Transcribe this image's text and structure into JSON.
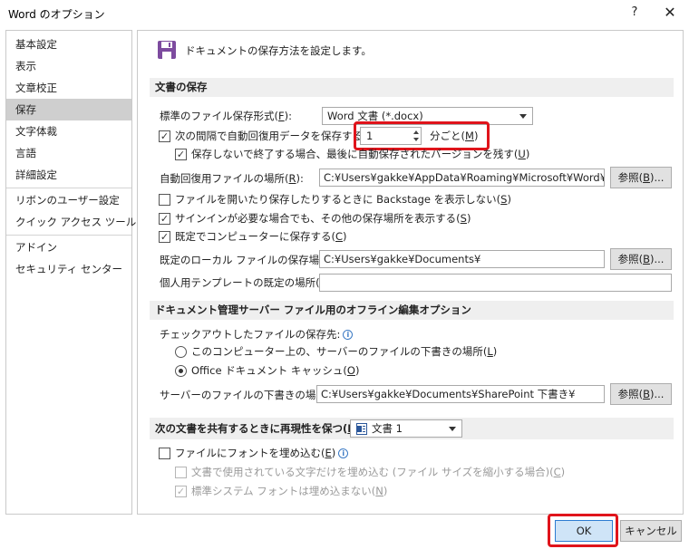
{
  "window": {
    "title": "Word のオプション",
    "help_label": "?",
    "close_label": "✕"
  },
  "nav": {
    "items": [
      {
        "label": "基本設定"
      },
      {
        "label": "表示"
      },
      {
        "label": "文章校正"
      },
      {
        "label": "保存",
        "selected": true
      },
      {
        "label": "文字体裁"
      },
      {
        "label": "言語"
      },
      {
        "label": "詳細設定"
      },
      {
        "label": "リボンのユーザー設定"
      },
      {
        "label": "クイック アクセス ツール バー"
      },
      {
        "label": "アドイン"
      },
      {
        "label": "セキュリティ センター"
      }
    ]
  },
  "header": {
    "icon": "save-icon",
    "text": "ドキュメントの保存方法を設定します。"
  },
  "save_section": {
    "title": "文書の保存",
    "format_label": "標準のファイル保存形式(",
    "format_key": "F",
    "format_label_end": "):",
    "format_value": "Word 文書 (*.docx)",
    "autorecover_label": "次の間隔で自動回復用データを保存する(",
    "autorecover_key": "A",
    "autorecover_label_end": "):",
    "autorecover_checked": true,
    "autorecover_minutes": "1",
    "minutes_label": "分ごと(",
    "minutes_key": "M",
    "minutes_label_end": ")",
    "keep_last_label": "保存しないで終了する場合、最後に自動保存されたバージョンを残す(",
    "keep_last_key": "U",
    "keep_last_label_end": ")",
    "keep_last_checked": true,
    "autorecover_location_label": "自動回復用ファイルの場所(",
    "autorecover_location_key": "R",
    "autorecover_location_label_end": "):",
    "autorecover_location_value": "C:¥Users¥gakke¥AppData¥Roaming¥Microsoft¥Word¥",
    "browse_label": "参照(",
    "browse_key": "B",
    "browse_label_end": ")...",
    "backstage_label": "ファイルを開いたり保存したりするときに Backstage を表示しない(",
    "backstage_key": "S",
    "backstage_label_end": ")",
    "backstage_checked": false,
    "signin_label": "サインインが必要な場合でも、その他の保存場所を表示する(",
    "signin_key": "S",
    "signin_label_end": ")",
    "signin_checked": true,
    "computer_default_label": "既定でコンピューターに保存する(",
    "computer_default_key": "C",
    "computer_default_label_end": ")",
    "computer_default_checked": true,
    "local_location_label": "既定のローカル ファイルの保存場所(",
    "local_location_key": "I",
    "local_location_label_end": "):",
    "local_location_value": "C:¥Users¥gakke¥Documents¥",
    "template_label": "個人用テンプレートの既定の場所(",
    "template_key": "T",
    "template_label_end": "):",
    "template_value": ""
  },
  "offline_section": {
    "title": "ドキュメント管理サーバー ファイル用のオフライン編集オプション",
    "checkout_label": "チェックアウトしたファイルの保存先:",
    "info_icon": "i",
    "radio1_label": "このコンピューター上の、サーバーのファイルの下書きの場所(",
    "radio1_key": "L",
    "radio1_label_end": ")",
    "radio2_label": "Office ドキュメント キャッシュ(",
    "radio2_key": "O",
    "radio2_label_end": ")",
    "selected_radio": 2,
    "drafts_label": "サーバーのファイルの下書きの場所(",
    "drafts_key": "V",
    "drafts_label_end": "):",
    "drafts_value": "C:¥Users¥gakke¥Documents¥SharePoint 下書き¥"
  },
  "fidelity_section": {
    "title": "次の文書を共有するときに再現性を保つ(",
    "title_key": "D",
    "title_end": "):",
    "document_value": "文書 1",
    "embed_label": "ファイルにフォントを埋め込む(",
    "embed_key": "E",
    "embed_label_end": ")",
    "embed_checked": false,
    "used_chars_label": "文書で使用されている文字だけを埋め込む (ファイル サイズを縮小する場合)(",
    "used_chars_key": "C",
    "used_chars_label_end": ")",
    "system_fonts_label": "標準システム フォントは埋め込まない(",
    "system_fonts_key": "N",
    "system_fonts_label_end": ")",
    "system_fonts_checked": true
  },
  "footer": {
    "ok_label": "OK",
    "cancel_label": "キャンセル"
  },
  "colors": {
    "highlight": "#e0141b",
    "selected_nav": "#cfcfcf",
    "section_bar": "#efefef"
  }
}
